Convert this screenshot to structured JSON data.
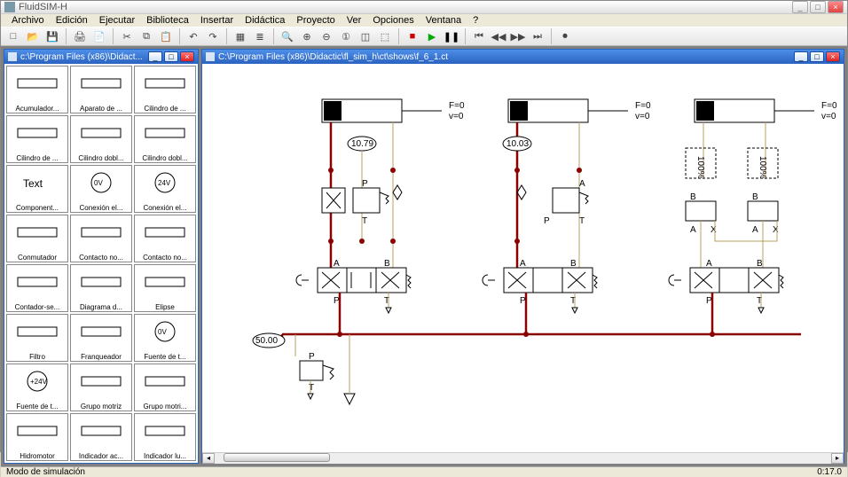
{
  "app": {
    "title": "FluidSIM-H"
  },
  "menu": {
    "items": [
      "Archivo",
      "Edición",
      "Ejecutar",
      "Biblioteca",
      "Insertar",
      "Didáctica",
      "Proyecto",
      "Ver",
      "Opciones",
      "Ventana",
      "?"
    ]
  },
  "toolbar": {
    "new": "□",
    "open": "📂",
    "save": "💾",
    "sep1": "|",
    "print": "🖨",
    "preview": "📄",
    "sep2": "|",
    "cut": "✂",
    "copy": "⧉",
    "paste": "📋",
    "sep3": "|",
    "undo": "↶",
    "redo": "↷",
    "sep4": "|",
    "grid": "▦",
    "layers": "≣",
    "sep5": "|",
    "zoomfit": "🔍",
    "zoomin": "⊕",
    "zoomout": "⊖",
    "zoom1": "①",
    "zoomsel": "◫",
    "zoomrgn": "⬚",
    "sep6": "|",
    "stop": "■",
    "play": "▶",
    "pause": "❚❚",
    "sep7": "|",
    "first": "⏮",
    "prev": "◀◀",
    "next": "▶▶",
    "last": "⏭",
    "sep8": "|",
    "rec": "⏺"
  },
  "subwin_left": {
    "title": "c:\\Program Files (x86)\\Didact..."
  },
  "subwin_right": {
    "title": "C:\\Program Files (x86)\\Didactic\\fl_sim_h\\ct\\shows\\f_6_1.ct"
  },
  "palette": [
    {
      "id": "acumulador",
      "label": "Acumulador..."
    },
    {
      "id": "aparato-de",
      "label": "Aparato de ..."
    },
    {
      "id": "cilindro-de-1",
      "label": "Cilindro de ..."
    },
    {
      "id": "cilindro-de-2",
      "label": "Cilindro de ..."
    },
    {
      "id": "cilindro-dobl-1",
      "label": "Cilindro dobl..."
    },
    {
      "id": "cilindro-dobl-2",
      "label": "Cilindro dobl..."
    },
    {
      "id": "text",
      "label": "Component..."
    },
    {
      "id": "conexion-0v",
      "label": "Conexión el...",
      "badge": "0V"
    },
    {
      "id": "conexion-24v",
      "label": "Conexión el...",
      "badge": "24V"
    },
    {
      "id": "conmutador",
      "label": "Conmutador"
    },
    {
      "id": "contacto-no-1",
      "label": "Contacto no..."
    },
    {
      "id": "contacto-no-2",
      "label": "Contacto no..."
    },
    {
      "id": "contador-se",
      "label": "Contador-se..."
    },
    {
      "id": "diagrama-d",
      "label": "Diagrama d..."
    },
    {
      "id": "elipse",
      "label": "Elipse"
    },
    {
      "id": "filtro",
      "label": "Filtro"
    },
    {
      "id": "franqueador",
      "label": "Franqueador"
    },
    {
      "id": "fuente-0v",
      "label": "Fuente de t...",
      "badge": "0V"
    },
    {
      "id": "fuente-24v",
      "label": "Fuente de t...",
      "badge": "+24V"
    },
    {
      "id": "grupo-motriz-1",
      "label": "Grupo motriz"
    },
    {
      "id": "grupo-motriz-2",
      "label": "Grupo motri..."
    },
    {
      "id": "hidromotor",
      "label": "Hidromotor"
    },
    {
      "id": "indicador-ac",
      "label": "Indicador ac..."
    },
    {
      "id": "indicador-lu",
      "label": "Indicador lu..."
    }
  ],
  "schematic": {
    "gauges": {
      "left": "10.79",
      "mid": "10.03",
      "supply": "50.00"
    },
    "cyl": {
      "F": "F=0",
      "v": "v=0",
      "pct": "100%"
    },
    "ports": {
      "A": "A",
      "B": "B",
      "P": "P",
      "T": "T",
      "X": "X"
    }
  },
  "status": {
    "mode": "Modo de simulación",
    "time": "0:17.0"
  }
}
